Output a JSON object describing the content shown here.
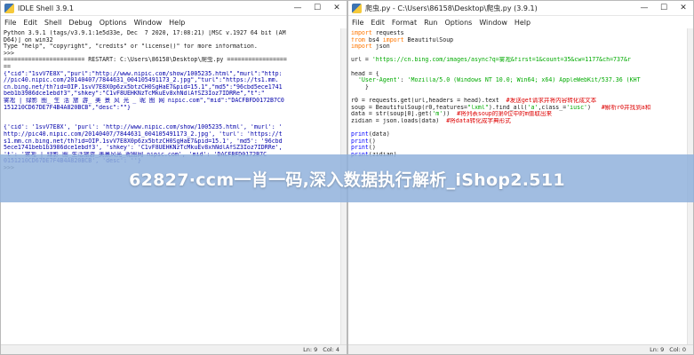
{
  "left_window": {
    "title": "IDLE Shell 3.9.1",
    "controls": [
      "—",
      "☐",
      "✕"
    ],
    "menu": [
      "File",
      "Edit",
      "Shell",
      "Debug",
      "Options",
      "Window",
      "Help"
    ],
    "lines": [
      "Python 3.9.1 (tags/v3.9.1:1e5d33e, Dec  7 2020, 17:08:21) [MSC v.1927 64 bit (AM",
      "D64)] on win32",
      "Type \"help\", \"copyright\", \"credits\" or \"license()\" for more information.",
      ">>>",
      "======================= RESTART: C:\\Users\\86158\\Desktop\\爬虫.py =================",
      "==",
      "{\"cid\":\"1svV7E8X\",\"purl\":\"http://www.nipic.com/show/1005235.html\",\"murl\":\"http:",
      "//pic40.nipic.com/20140407/7844631_004105491173_2.jpg\",\"turl\":\"https://ts1.mm.",
      "cn.bing.net/th?id=OIP.1svV7E8X0p6zx5btzCH0SgHaE7&pid=15.1\",\"md5\":\"96cbd5ece1741",
      "beb1b3986dce1ebdf3\",\"shkey\":\"C1vF8UEHKNzTcMkuEv8xhNdlAfSZ3Ioz7IDRRe\",\"t\":\"",
      "雾凇 | 绿影 图_ 生 活 旅 游_ 美 景 风 光 _ 昵 图 网 nipic.com\",\"mid\":\"DACFBFD0172B7C0",
      "151210CD67DE7F4B4A820BCB\",\"desc\":\"\"}",
      "",
      "",
      "{'cid': '1svV7E8X', 'purl': 'http://www.nipic.com/show/1005235.html', 'murl': '",
      "http://pic40.nipic.com/20140407/7844631_004105491173_2.jpg', 'turl': 'https://t",
      "s1.mm.cn.bing.net/th?id=OIP.1svV7E8X0p6zx5btzCH0SgHaE7&pid=15.1', 'md5': '96cbd",
      "5ece1741beb1b3986dce1ebdf3', 'shkey': 'C1vF8UEHKNzTcMkuEv8xhNdlAfSZ3Ioz7IDRRe',",
      "'t': '雾凇 | 绿影 图_生活旅游_美景风光_昵图网 nipic.com', 'mid': 'DACFBFD0172B7C",
      "0151210CD67DE7F4B4A820BCB', 'desc': ''}",
      ">>>"
    ],
    "status": {
      "ln": "Ln: 9",
      "col": "Col: 4"
    }
  },
  "right_window": {
    "title": "爬虫.py - C:\\Users\\86158\\Desktop\\爬虫.py (3.9.1)",
    "controls": [
      "—",
      "☐",
      "✕"
    ],
    "menu": [
      "File",
      "Edit",
      "Format",
      "Run",
      "Options",
      "Window",
      "Help"
    ],
    "code": [
      [
        [
          "kw",
          "import"
        ],
        [
          "",
          " requests"
        ]
      ],
      [
        [
          "kw",
          "from"
        ],
        [
          "",
          " bs4 "
        ],
        [
          "kw",
          "import"
        ],
        [
          "",
          " BeautifulSoup"
        ]
      ],
      [
        [
          "kw",
          "import"
        ],
        [
          "",
          " json"
        ]
      ],
      [
        [
          "",
          ""
        ]
      ],
      [
        [
          "",
          "url = "
        ],
        [
          "str",
          "'https://cn.bing.com/images/async?q=雾凇&first=1&count=35&cw=1177&ch=737&r"
        ]
      ],
      [
        [
          "",
          ""
        ]
      ],
      [
        [
          "",
          "head = {"
        ]
      ],
      [
        [
          "",
          "  "
        ],
        [
          "str",
          "'User-Agent'"
        ],
        [
          "",
          ": "
        ],
        [
          "str",
          "'Mozilla/5.0 (Windows NT 10.0; Win64; x64) AppleWebKit/537.36 (KHT"
        ]
      ],
      [
        [
          "",
          "    }"
        ]
      ],
      [
        [
          "",
          ""
        ]
      ],
      [
        [
          "",
          "r0 = requests.get(url,headers = head).text  "
        ],
        [
          "cm",
          "#发送get请求并将内容转化成文本"
        ]
      ],
      [
        [
          "",
          "soup = BeautifulSoup(r0,features="
        ],
        [
          "str",
          "\"lxml\""
        ],
        [
          "",
          ").find_all("
        ],
        [
          "str",
          "'a'"
        ],
        [
          "",
          ",class_="
        ],
        [
          "str",
          "'iusc'"
        ],
        [
          "",
          ")   "
        ],
        [
          "cm",
          "#解析r0并找到a和"
        ]
      ],
      [
        [
          "",
          "data = str(soup[0].get("
        ],
        [
          "str",
          "'m'"
        ],
        [
          "",
          "))  "
        ],
        [
          "cm",
          "#将列表soup的第0位中的m值取出来"
        ]
      ],
      [
        [
          "",
          "zidian = json.loads(data)  "
        ],
        [
          "cm",
          "#将data转化成字典形式"
        ]
      ],
      [
        [
          "",
          ""
        ]
      ],
      [
        [
          "blue",
          "print"
        ],
        [
          "",
          "(data)"
        ]
      ],
      [
        [
          "blue",
          "print"
        ],
        [
          "",
          "()"
        ]
      ],
      [
        [
          "blue",
          "print"
        ],
        [
          "",
          "()"
        ]
      ],
      [
        [
          "blue",
          "print"
        ],
        [
          "",
          "(zidian)"
        ]
      ]
    ],
    "status": {
      "ln": "Ln: 9",
      "col": "Col: 0"
    }
  },
  "overlay": {
    "text": "62827·ccm一肖一码,深入数据执行解析_iShop2.511"
  }
}
